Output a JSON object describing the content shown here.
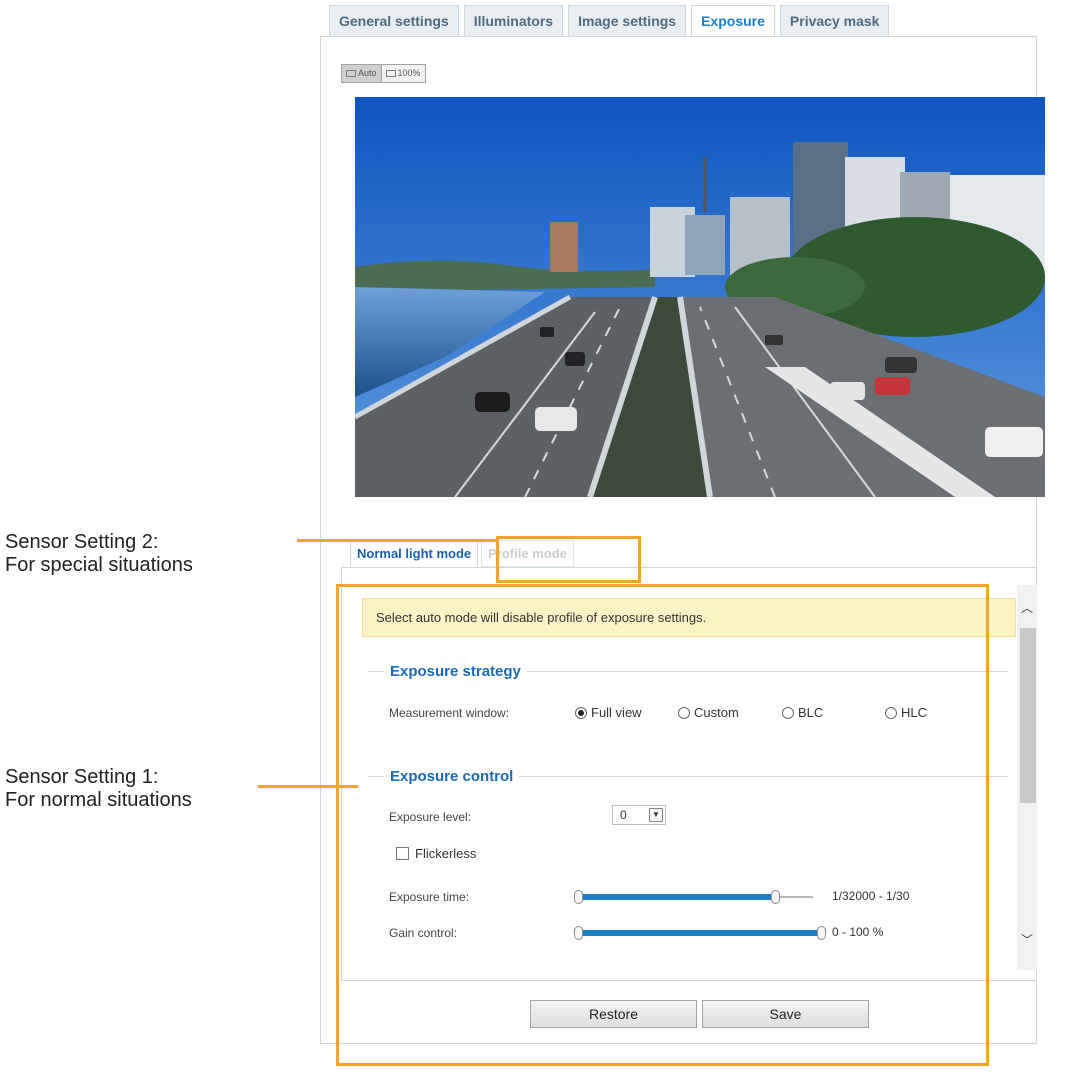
{
  "tabs": [
    {
      "label": "General settings",
      "active": false
    },
    {
      "label": "Illuminators",
      "active": false
    },
    {
      "label": "Image settings",
      "active": false
    },
    {
      "label": "Exposure",
      "active": true
    },
    {
      "label": "Privacy mask",
      "active": false
    }
  ],
  "zoom": {
    "auto_label": "Auto",
    "full_label": "100%",
    "icon": "frame-icon"
  },
  "video": {
    "description_icon": "camera-live-view"
  },
  "mode_tabs": {
    "normal": "Normal light mode",
    "profile": "Profile mode"
  },
  "notice": "Select auto mode will disable profile of exposure settings.",
  "exposure_strategy": {
    "title": "Exposure strategy",
    "measurement_label": "Measurement window:",
    "options": [
      {
        "label": "Full view",
        "checked": true
      },
      {
        "label": "Custom",
        "checked": false
      },
      {
        "label": "BLC",
        "checked": false
      },
      {
        "label": "HLC",
        "checked": false
      }
    ]
  },
  "exposure_control": {
    "title": "Exposure control",
    "level_label": "Exposure level:",
    "level_value": "0",
    "flickerless_label": "Flickerless",
    "flickerless_checked": false,
    "time_label": "Exposure time:",
    "time_value": "1/32000 - 1/30",
    "time_fill_fraction": 0.84,
    "gain_label": "Gain control:",
    "gain_value": "0 - 100 %",
    "gain_fill_fraction": 1.0
  },
  "buttons": {
    "restore": "Restore",
    "save": "Save"
  },
  "callouts": {
    "setting2_line1": "Sensor Setting 2:",
    "setting2_line2": "For special situations",
    "setting1_line1": "Sensor Setting 1:",
    "setting1_line2": "For normal situations"
  },
  "colors": {
    "accent": "#1b7fc5",
    "callout": "#f2a52a",
    "notice_bg": "#fbf3c4"
  }
}
